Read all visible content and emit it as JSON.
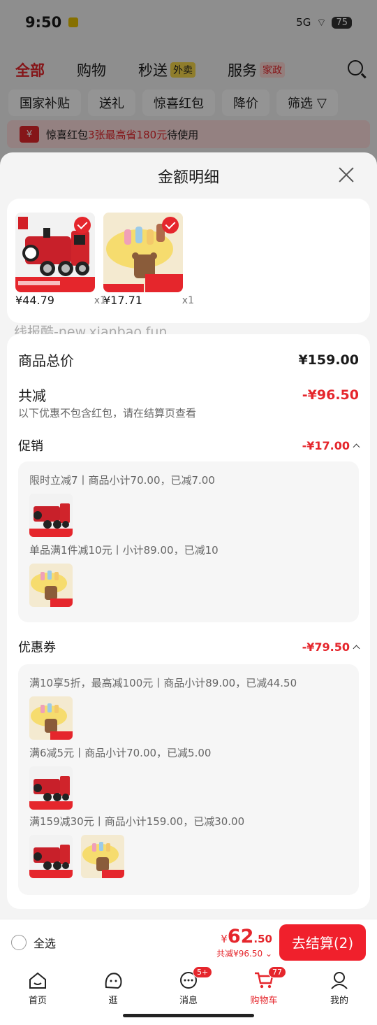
{
  "status_bar": {
    "time": "9:50",
    "signal": "5G",
    "battery": "75"
  },
  "top_nav": {
    "tabs": [
      {
        "label": "全部",
        "chip": ""
      },
      {
        "label": "购物",
        "chip": ""
      },
      {
        "label": "秒送",
        "chip": "外卖"
      },
      {
        "label": "服务",
        "chip": "家政"
      }
    ]
  },
  "filters": [
    "国家补贴",
    "送礼",
    "惊喜红包",
    "降价",
    "筛选"
  ],
  "banner": {
    "prefix": "惊喜红包",
    "highlight": "3张最高省180元",
    "suffix": "待使用"
  },
  "sheet": {
    "title": "金额明细",
    "products": [
      {
        "price": "¥44.79",
        "qty": "x1",
        "name": "train"
      },
      {
        "price": "¥17.71",
        "qty": "x1",
        "name": "toy"
      }
    ],
    "watermark": "线报酷-new.xianbao.fun",
    "total_label": "商品总价",
    "total_value": "¥159.00",
    "reduce_label": "共减",
    "reduce_value": "-¥96.50",
    "reduce_note": "以下优惠不包含红包，请在结算页查看",
    "promo": {
      "label": "促销",
      "value": "-¥17.00",
      "lines": [
        "限时立减7丨商品小计70.00，已减7.00",
        "单品满1件减10元丨小计89.00，已减10"
      ]
    },
    "coupon": {
      "label": "优惠券",
      "value": "-¥79.50",
      "lines": [
        "满10享5折，最高减100元丨商品小计89.00，已减44.50",
        "满6减5元丨商品小计70.00，已减5.00",
        "满159减30元丨商品小计159.00，已减30.00"
      ]
    }
  },
  "bottom_bar": {
    "select_all": "全选",
    "amount_yen": "¥",
    "amount_int": "62",
    "amount_dec": ".50",
    "saved": "共减¥96.50",
    "checkout": "去结算(2)"
  },
  "tab_bar": {
    "tabs": [
      {
        "label": "首页",
        "badge": ""
      },
      {
        "label": "逛",
        "badge": ""
      },
      {
        "label": "消息",
        "badge": "5+"
      },
      {
        "label": "购物车",
        "badge": "77"
      },
      {
        "label": "我的",
        "badge": ""
      }
    ]
  },
  "colors": {
    "accent": "#e5262c"
  }
}
